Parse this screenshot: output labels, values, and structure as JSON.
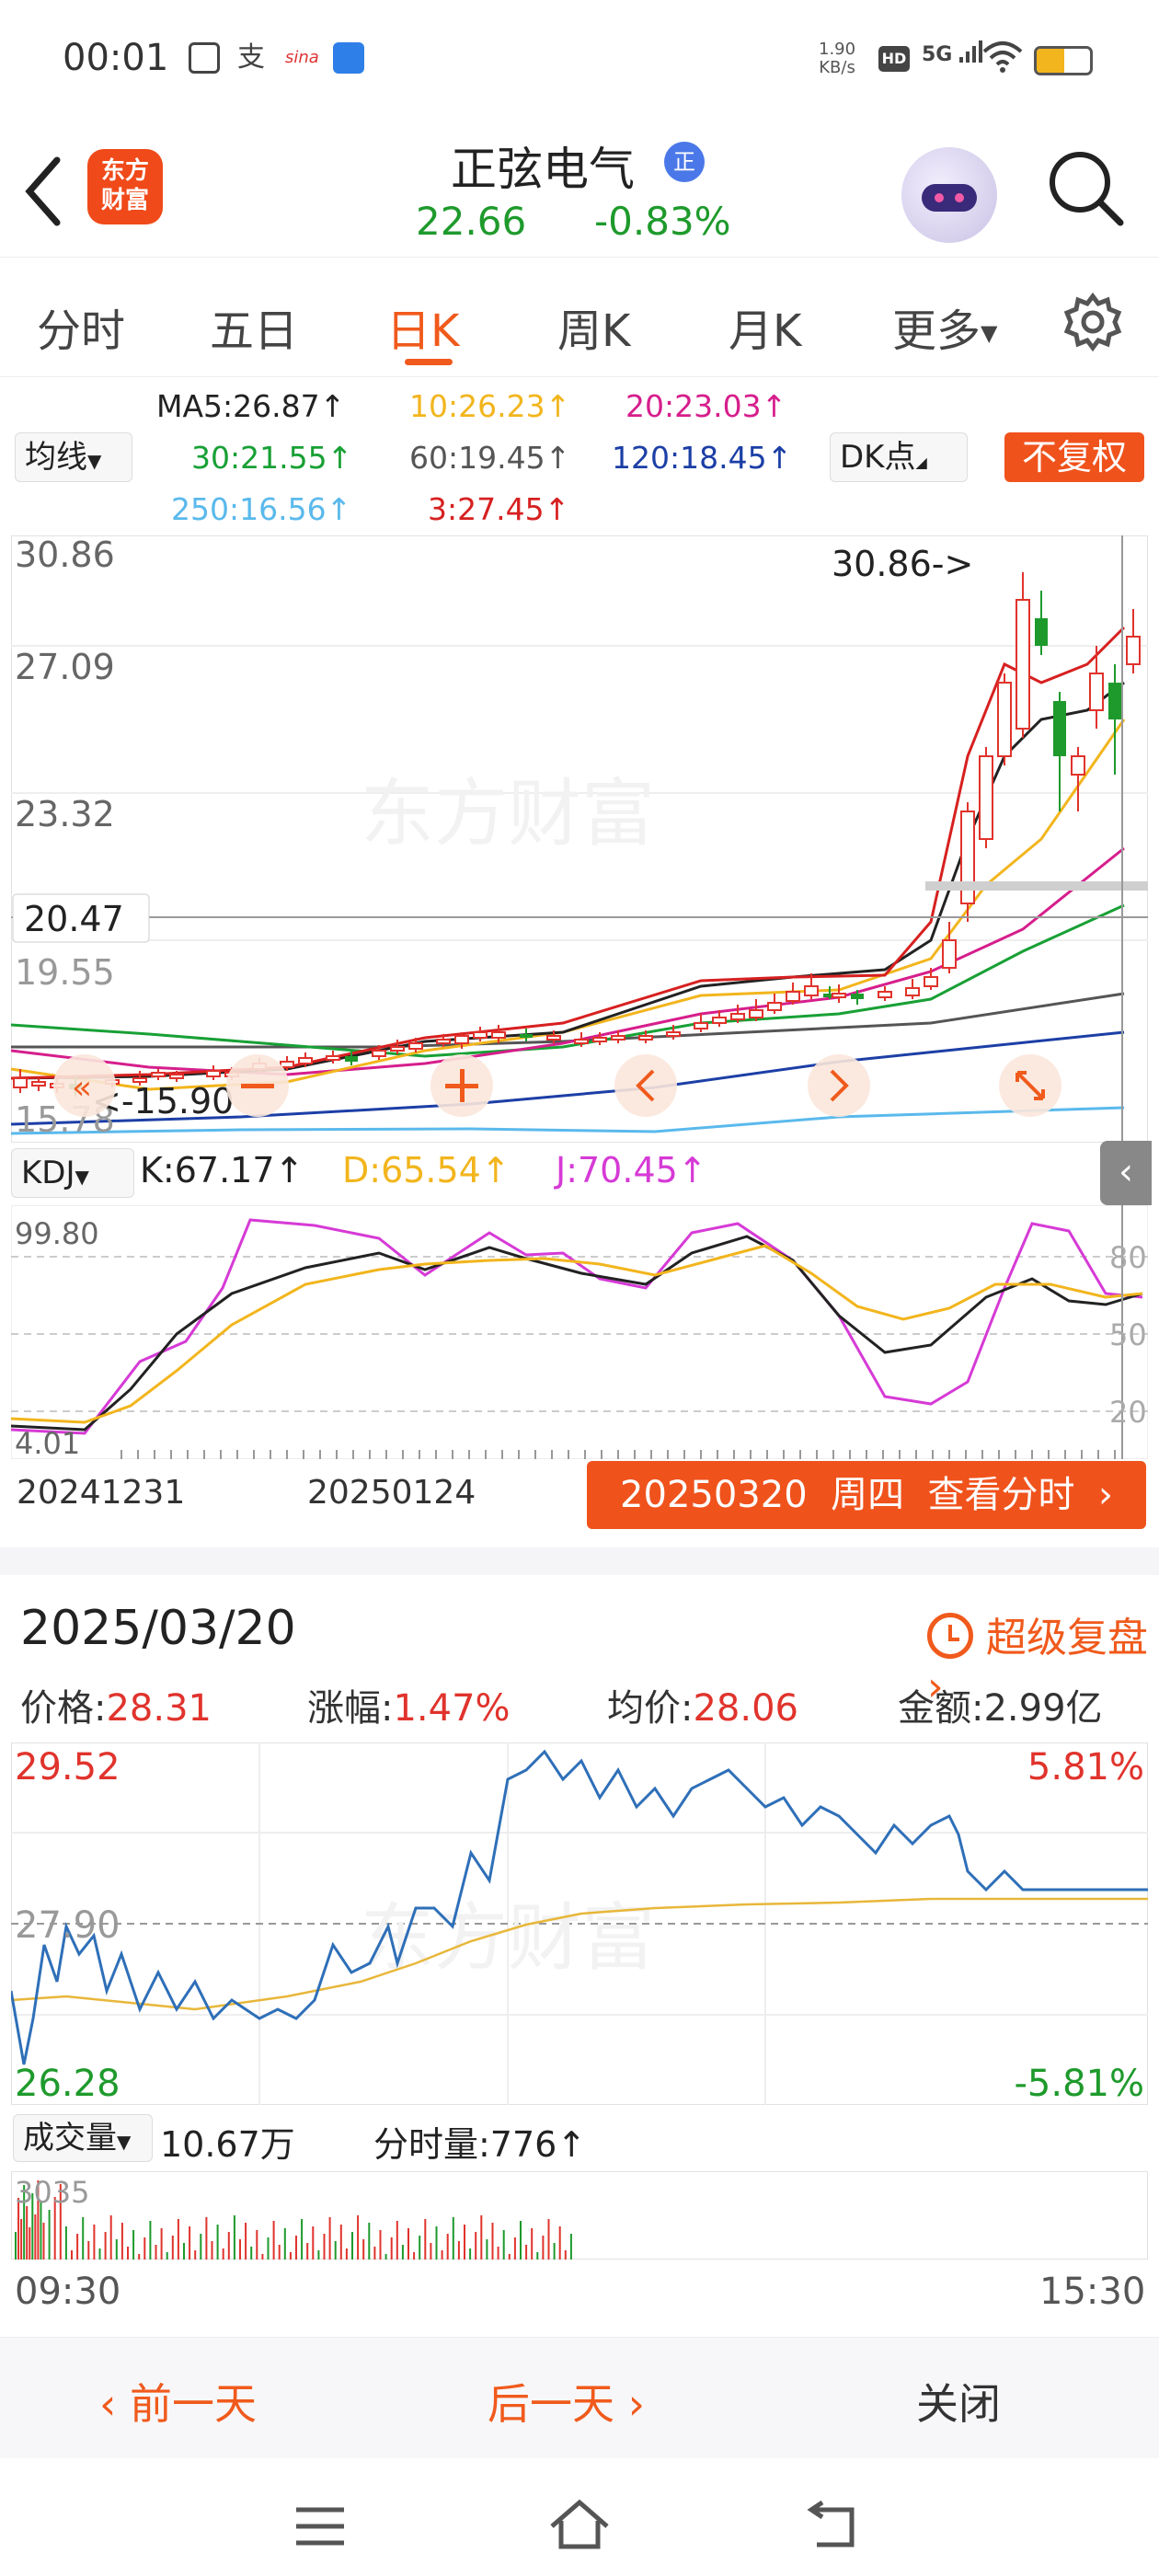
{
  "status_bar": {
    "time": "00:01",
    "net_speed_value": "1.90",
    "net_speed_unit": "KB/s",
    "hd": "HD",
    "signal": "5G"
  },
  "header": {
    "logo_line1": "东方",
    "logo_line2": "财富",
    "stock_name": "正弦电气",
    "badge": "正",
    "price": "22.66",
    "change_pct": "-0.83%"
  },
  "tabs": [
    {
      "label": "分时"
    },
    {
      "label": "五日"
    },
    {
      "label": "日K"
    },
    {
      "label": "周K"
    },
    {
      "label": "月K"
    },
    {
      "label": "更多"
    }
  ],
  "ma_legend": {
    "ma5": "MA5:26.87↑",
    "ma10": "10:26.23↑",
    "ma20": "20:23.03↑",
    "ma30": "30:21.55↑",
    "ma60": "60:19.45↑",
    "ma120": "120:18.45↑",
    "ma250": "250:16.56↑",
    "ma3": "3:27.45↑",
    "indicator_select": "均线",
    "dk_select": "DK点",
    "fq_button": "不复权"
  },
  "colors": {
    "ma5": "#222222",
    "ma10": "#f2b51d",
    "ma20": "#d61e8c",
    "ma30": "#18a035",
    "ma60": "#555555",
    "ma120": "#1c3fa6",
    "ma250": "#5ab9ec",
    "ma3": "#d72020",
    "up": "#e0332c",
    "down": "#1e9a2c",
    "accent": "#f05a1c",
    "price_line": "#2e6fb8",
    "avg_line": "#e8b73a"
  },
  "kline": {
    "y_labels": [
      "30.86",
      "27.09",
      "23.32",
      "19.55",
      "15.78"
    ],
    "cursor_price": "20.47",
    "max_marker": "30.86->",
    "min_marker": "<-15.90",
    "watermark": "东方财富"
  },
  "kdj": {
    "select": "KDJ",
    "k": "K:67.17↑",
    "d": "D:65.54↑",
    "j": "J:70.45↑",
    "top_label": "99.80",
    "bottom_label": "4.01",
    "right_labels": [
      "80",
      "50",
      "20"
    ]
  },
  "dates": {
    "left": "20241231",
    "mid": "20250124",
    "selected": "20250320",
    "weekday": "周四",
    "view_intraday": "查看分时"
  },
  "day_panel": {
    "date": "2025/03/20",
    "replay": "超级复盘",
    "price_label": "价格:",
    "price": "28.31",
    "change_label": "涨幅:",
    "change": "1.47%",
    "avg_label": "均价:",
    "avg": "28.06",
    "amount_label": "金额:",
    "amount": "2.99亿",
    "y_top": "29.52",
    "y_mid": "27.90",
    "y_bottom": "26.28",
    "pct_top": "5.81%",
    "pct_bottom": "-5.81%",
    "vol_select": "成交量",
    "vol_total": "10.67万",
    "vol_minute": "分时量:776↑",
    "vol_axis": "3035",
    "time_start": "09:30",
    "time_end": "15:30"
  },
  "bottom_bar": {
    "prev": "前一天",
    "next": "后一天",
    "close": "关闭"
  }
}
